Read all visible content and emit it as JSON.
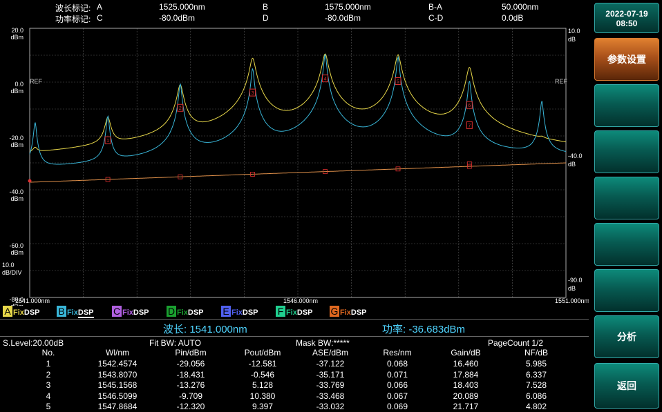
{
  "header": {
    "wl_marker_label": "波长标记:",
    "pw_marker_label": "功率标记:",
    "a_label": "A",
    "a_value": "1525.000nm",
    "b_label": "B",
    "b_value": "1575.000nm",
    "ba_label": "B-A",
    "ba_value": "50.000nm",
    "c_label": "C",
    "c_value": "-80.0dBm",
    "d_label": "D",
    "d_value": "-80.0dBm",
    "cd_label": "C-D",
    "cd_value": "0.0dB"
  },
  "plot": {
    "left_axis": [
      {
        "value": "20.0",
        "unit": "dBm"
      },
      {
        "value": "0.0",
        "unit": "dBm"
      },
      {
        "value": "-20.0",
        "unit": "dBm"
      },
      {
        "value": "-40.0",
        "unit": "dBm"
      },
      {
        "value": "-60.0",
        "unit": "dBm"
      },
      {
        "value": "-80.0",
        "unit": "dBm"
      }
    ],
    "scale_value": "10.0",
    "scale_unit": "dB/DIV",
    "ref_label_left": "REF",
    "ref_label_right": "REF",
    "right_axis": [
      {
        "value": "10.0",
        "unit": "dB"
      },
      {
        "value": "-40.0",
        "unit": "dB"
      },
      {
        "value": "-90.0",
        "unit": "dB"
      }
    ],
    "x_start": "1541.000nm",
    "x_center": "1546.000nm",
    "x_end": "1551.000nm",
    "channel_markers": [
      "1",
      "2",
      "3",
      "4",
      "5",
      "6",
      "7"
    ],
    "colors": {
      "trace_a": "#e8d84a",
      "trace_b": "#39b6d8",
      "fit": "#e0904a",
      "marker": "#e03030",
      "grid": "#5a5a5a"
    }
  },
  "chart_data": {
    "type": "line",
    "x_unit": "nm",
    "y_unit": "dBm",
    "xlim": [
      1541.0,
      1551.0
    ],
    "ylim": [
      -80.0,
      20.0
    ],
    "series": [
      {
        "name": "A",
        "peaks_x": [
          1541.1,
          1542.4574,
          1543.807,
          1545.1568,
          1546.5099,
          1547.8684,
          1549.2,
          1550.55
        ],
        "peaks_y": [
          -29,
          -13.5,
          -1.0,
          8.9,
          10.5,
          10.2,
          5.5,
          -30
        ]
      },
      {
        "name": "B",
        "peaks_x": [
          1541.1,
          1542.4574,
          1543.807,
          1545.1568,
          1546.5099,
          1547.8684,
          1549.2,
          1550.55
        ],
        "peaks_y": [
          -15,
          -12.581,
          -0.546,
          5.128,
          10.38,
          9.397,
          0.5,
          -7
        ]
      }
    ]
  },
  "traces": [
    {
      "letter": "A",
      "fix": "Fix",
      "dsp": "DSP",
      "color": "#e8d84a"
    },
    {
      "letter": "B",
      "fix": "Fix",
      "dsp": "DSP",
      "color": "#39b6d8"
    },
    {
      "letter": "C",
      "fix": "Fix",
      "dsp": "DSP",
      "color": "#b060e0"
    },
    {
      "letter": "D",
      "fix": "Fix",
      "dsp": "DSP",
      "color": "#1aa030"
    },
    {
      "letter": "E",
      "fix": "Fix",
      "dsp": "DSP",
      "color": "#5060f0"
    },
    {
      "letter": "F",
      "fix": "Fix",
      "dsp": "DSP",
      "color": "#20d090"
    },
    {
      "letter": "G",
      "fix": "Fix",
      "dsp": "DSP",
      "color": "#e06820"
    }
  ],
  "cursor": {
    "wavelength": "波长: 1541.000nm",
    "power": "功率: -36.683dBm"
  },
  "table": {
    "s_level": "S.Level:20.00dB",
    "fit_bw": "Fit BW: AUTO",
    "mask_bw": "Mask BW:*****",
    "page_count": "PageCount  1/2",
    "headers": [
      "No.",
      "Wl/nm",
      "Pin/dBm",
      "Pout/dBm",
      "ASE/dBm",
      "Res/nm",
      "Gain/dB",
      "NF/dB"
    ],
    "rows": [
      [
        "1",
        "1542.4574",
        "-29.056",
        "-12.581",
        "-37.122",
        "0.068",
        "16.460",
        "5.985"
      ],
      [
        "2",
        "1543.8070",
        "-18.431",
        "-0.546",
        "-35.171",
        "0.071",
        "17.884",
        "6.337"
      ],
      [
        "3",
        "1545.1568",
        "-13.276",
        "5.128",
        "-33.769",
        "0.066",
        "18.403",
        "7.528"
      ],
      [
        "4",
        "1546.5099",
        "-9.709",
        "10.380",
        "-33.468",
        "0.067",
        "20.089",
        "6.086"
      ],
      [
        "5",
        "1547.8684",
        "-12.320",
        "9.397",
        "-33.032",
        "0.069",
        "21.717",
        "4.802"
      ]
    ]
  },
  "side": {
    "date": "2022-07-19",
    "time": "08:50",
    "buttons": [
      "参数设置",
      "",
      "",
      "",
      "",
      "",
      "",
      "分析",
      "返回"
    ]
  }
}
